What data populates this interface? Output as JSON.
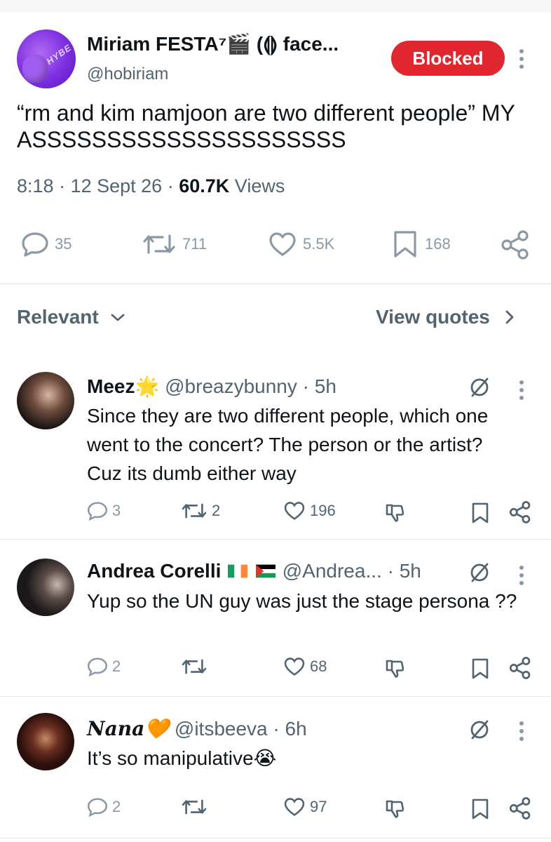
{
  "main_tweet": {
    "display_name": "Miriam FESTA⁷🎬 (⟬⟭ face...",
    "handle": "@hobiriam",
    "follow_state": "Blocked",
    "text": "“rm and kim namjoon are two different people” MY ASSSSSSSSSSSSSSSSSSSSS",
    "time": "8:18",
    "date": "12 Sept 26",
    "views_count": "60.7K",
    "views_label": "Views",
    "replies": "35",
    "reposts": "711",
    "likes": "5.5K",
    "bookmarks": "168"
  },
  "sort": {
    "label": "Relevant",
    "quotes_label": "View quotes"
  },
  "replies": [
    {
      "name": "Meez🌟",
      "handle": "@breazybunny",
      "age": "5h",
      "text": "Since they are two different people, which one went to the concert? The person or the artist? Cuz its dumb either way",
      "replies": "3",
      "reposts": "2",
      "likes": "196"
    },
    {
      "name": "Andrea Corelli",
      "flags": [
        "ireland",
        "palestine"
      ],
      "handle": "@Andrea...",
      "age": "5h",
      "text": "Yup so the UN guy was just the stage persona ??",
      "replies": "2",
      "reposts": "",
      "likes": "68"
    },
    {
      "name": "Nana🧡",
      "handle": "@itsbeeva",
      "age": "6h",
      "text": "It’s so manipulative😭",
      "replies": "2",
      "reposts": "",
      "likes": "97"
    }
  ],
  "icons": [
    "reply-icon",
    "repost-icon",
    "like-icon",
    "bookmark-icon",
    "share-icon",
    "grok-icon",
    "more-icon",
    "downvote-icon",
    "chevron-down-icon",
    "chevron-right-icon"
  ],
  "colors": {
    "blocked": "#e0272f",
    "muted": "#536471",
    "icon": "#8b98a5",
    "text": "#0f1419"
  }
}
